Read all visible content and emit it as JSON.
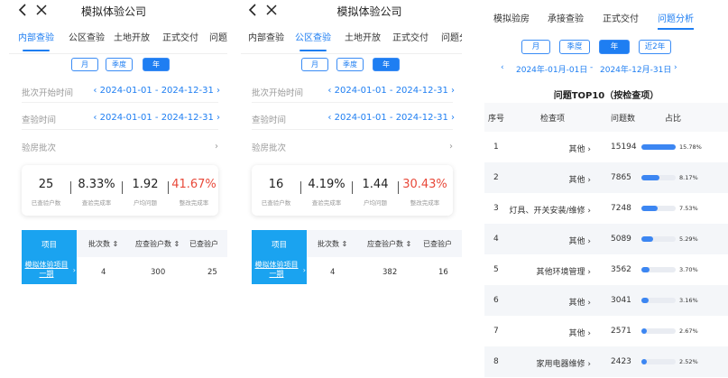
{
  "company_title": "模拟体验公司",
  "tabs": [
    "内部查验",
    "公区查验",
    "土地开放",
    "正式交付",
    "问题分"
  ],
  "periods": [
    "月",
    "季度",
    "年"
  ],
  "filters": {
    "start_label": "批次开始时间",
    "start_value": "2024-01-01  -  2024-12-31",
    "check_label": "查验时间",
    "check_value": "2024-01-01  -  2024-12-31",
    "batch_label": "验房批次"
  },
  "stat_captions": [
    "已查验户数",
    "查验完成率",
    "户均问题",
    "整改完成率"
  ],
  "panel1": {
    "stats": [
      "25",
      "8.33%",
      "1.92",
      "41.67%"
    ],
    "table": {
      "project_header": "项目",
      "headers": [
        "批次数",
        "应查验户数",
        "已查验户"
      ],
      "project_name": "模拟体验项目一期",
      "values": [
        "4",
        "300",
        "25"
      ]
    }
  },
  "panel2": {
    "stats": [
      "16",
      "4.19%",
      "1.44",
      "30.43%"
    ],
    "table": {
      "project_header": "项目",
      "headers": [
        "批次数",
        "应查验户数",
        "已查验户"
      ],
      "project_name": "模拟体验项目一期",
      "values": [
        "4",
        "382",
        "16"
      ]
    }
  },
  "panel3": {
    "tabs": [
      "模拟验房",
      "承接查验",
      "正式交付",
      "问题分析"
    ],
    "periods": [
      "月",
      "季度",
      "年",
      "近2年"
    ],
    "date_start": "2024年-01月-01日",
    "date_sep": "-",
    "date_end": "2024年-12月-31日",
    "table_title": "问题TOP10（按检查项）",
    "headers": [
      "序号",
      "检查项",
      "问题数",
      "占比"
    ],
    "rows": [
      {
        "no": "1",
        "item": "其他",
        "count": "15194",
        "pct": "15.78%",
        "frac": 1.0
      },
      {
        "no": "2",
        "item": "其他",
        "count": "7865",
        "pct": "8.17%",
        "frac": 0.52
      },
      {
        "no": "3",
        "item": "灯具、开关安装/维修",
        "count": "7248",
        "pct": "7.53%",
        "frac": 0.48
      },
      {
        "no": "4",
        "item": "其他",
        "count": "5089",
        "pct": "5.29%",
        "frac": 0.34
      },
      {
        "no": "5",
        "item": "其他环境管理",
        "count": "3562",
        "pct": "3.70%",
        "frac": 0.23
      },
      {
        "no": "6",
        "item": "其他",
        "count": "3041",
        "pct": "3.16%",
        "frac": 0.2
      },
      {
        "no": "7",
        "item": "其他",
        "count": "2571",
        "pct": "2.67%",
        "frac": 0.17
      },
      {
        "no": "8",
        "item": "家用电器维修",
        "count": "2423",
        "pct": "2.52%",
        "frac": 0.16
      }
    ]
  },
  "colors": {
    "accent": "#1e7ef2",
    "project_cell": "#1aa3f0",
    "highlight_red": "#e8493a",
    "bar": "#3c86f2"
  }
}
